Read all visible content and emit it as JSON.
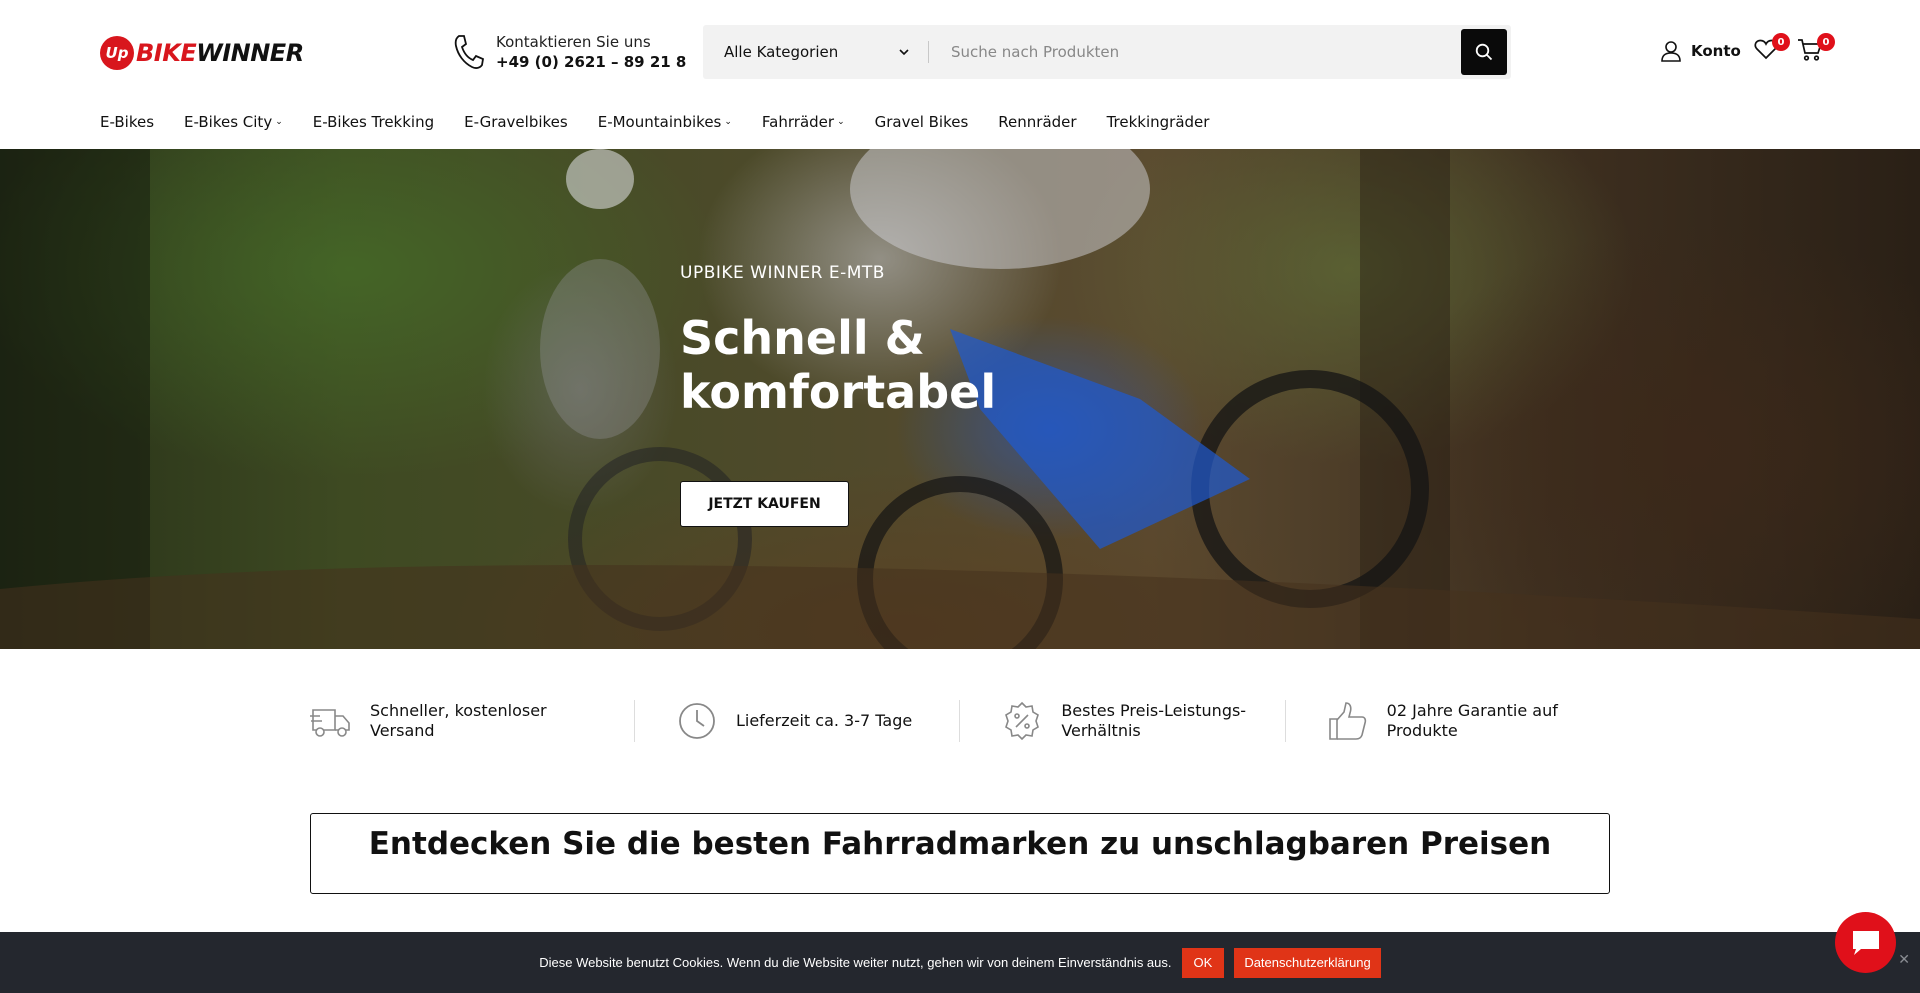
{
  "logo": {
    "badge": "Up",
    "text_red": "BIKE",
    "text_dark": "WINNER"
  },
  "contact": {
    "label": "Kontaktieren Sie uns",
    "phone": "+49 (0) 2621 – 89 21 8"
  },
  "search": {
    "category": "Alle Kategorien",
    "placeholder": "Suche nach Produkten"
  },
  "account": {
    "label": "Konto"
  },
  "wishlist": {
    "count": "0"
  },
  "cart": {
    "count": "0"
  },
  "nav": [
    {
      "label": "E-Bikes",
      "dropdown": false
    },
    {
      "label": "E-Bikes City",
      "dropdown": true
    },
    {
      "label": "E-Bikes Trekking",
      "dropdown": false
    },
    {
      "label": "E-Gravelbikes",
      "dropdown": false
    },
    {
      "label": "E-Mountainbikes",
      "dropdown": true
    },
    {
      "label": "Fahrräder",
      "dropdown": true
    },
    {
      "label": "Gravel Bikes",
      "dropdown": false
    },
    {
      "label": "Rennräder",
      "dropdown": false
    },
    {
      "label": "Trekkingräder",
      "dropdown": false
    }
  ],
  "hero": {
    "subtitle": "UPBIKE WINNER E-MTB",
    "title": "Schnell & komfortabel",
    "button": "JETZT KAUFEN"
  },
  "features": [
    {
      "icon": "truck-icon",
      "text": "Schneller, kostenloser Versand"
    },
    {
      "icon": "clock-icon",
      "text": "Lieferzeit ca. 3-7 Tage"
    },
    {
      "icon": "discount-badge-icon",
      "text": "Bestes Preis-Leistungs-Verhältnis"
    },
    {
      "icon": "thumbs-up-icon",
      "text": "02 Jahre Garantie auf Produkte"
    }
  ],
  "brands": {
    "title": "Entdecken Sie die besten Fahrradmarken zu unschlagbaren Preisen"
  },
  "cookie": {
    "text": "Diese Website benutzt Cookies. Wenn du die Website weiter nutzt, gehen wir von deinem Einverständnis aus.",
    "ok": "OK",
    "policy": "Datenschutzerklärung",
    "close": "✕"
  },
  "colors": {
    "brand_red": "#d8161d",
    "cookie_bg": "#24272e",
    "cookie_button": "#e03417"
  }
}
